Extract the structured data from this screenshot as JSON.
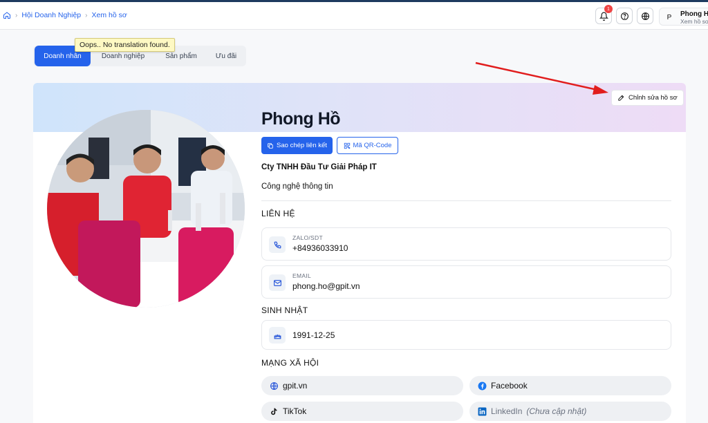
{
  "breadcrumb": {
    "items": [
      "Hội Doanh Nghiệp",
      "Xem hồ sơ"
    ]
  },
  "header": {
    "notification_count": "1",
    "user": {
      "initial": "P",
      "name": "Phong Hồ",
      "subtitle": "Xem hồ sơ"
    }
  },
  "tooltip": "Oops.. No translation found.",
  "tabs": [
    {
      "label": "Doanh nhân",
      "active": true
    },
    {
      "label": "Doanh nghiệp",
      "active": false
    },
    {
      "label": "Sản phẩm",
      "active": false
    },
    {
      "label": "Ưu đãi",
      "active": false
    }
  ],
  "profile": {
    "edit_label": "Chỉnh sửa hồ sơ",
    "name": "Phong Hồ",
    "copy_link_label": "Sao chép liên kết",
    "qr_label": "Mã QR-Code",
    "company": "Cty TNHH Đầu Tư Giải Pháp IT",
    "industry": "Công nghệ thông tin"
  },
  "contact": {
    "title": "LIÊN HỆ",
    "phone": {
      "label": "ZALO/SDT",
      "value": "+84936033910"
    },
    "email": {
      "label": "EMAIL",
      "value": "phong.ho@gpit.vn"
    }
  },
  "birthday": {
    "title": "SINH NHẬT",
    "value": "1991-12-25"
  },
  "social": {
    "title": "MẠNG XÃ HỘI",
    "website": "gpit.vn",
    "facebook": "Facebook",
    "tiktok": "TikTok",
    "linkedin": "LinkedIn",
    "linkedin_note": "(Chưa cập nhật)"
  },
  "colors": {
    "primary": "#2563eb",
    "annotation_arrow": "#e11d1d",
    "facebook": "#1877f2",
    "linkedin": "#0a66c2"
  }
}
